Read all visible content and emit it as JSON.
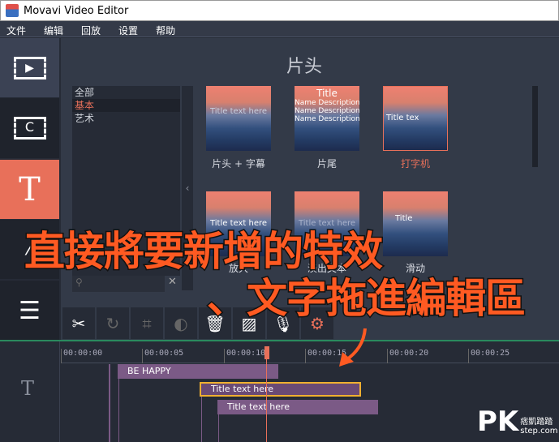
{
  "window": {
    "title": "Movavi Video Editor"
  },
  "menu": [
    "文件",
    "编辑",
    "回放",
    "设置",
    "帮助"
  ],
  "panel": {
    "title": "片头",
    "categories": [
      {
        "label": "全部",
        "selected": false
      },
      {
        "label": "基本",
        "selected": true
      },
      {
        "label": "艺术",
        "selected": false
      }
    ],
    "thumbs": [
      {
        "label": "片头 + 字幕",
        "text": "Title text here"
      },
      {
        "label": "片尾",
        "text": "Title",
        "sub": "Name Description\nName Description\nName Description"
      },
      {
        "label": "打字机",
        "text": "Title tex",
        "selected": true
      },
      {
        "label": "放大",
        "text": "Title text here"
      },
      {
        "label": "淡出文本",
        "text": "Title text here"
      },
      {
        "label": "滑动",
        "text": "Title"
      }
    ]
  },
  "timeline": {
    "ticks": [
      "00:00:00",
      "00:00:05",
      "00:00:10",
      "00:00:15",
      "00:00:20",
      "00:00:25"
    ],
    "clips": [
      "BE HAPPY",
      "Title text here",
      "Title text here"
    ]
  },
  "overlay": {
    "line1": "直接將要新增的特效",
    "line2": "、文字拖進編輯區"
  },
  "watermark": {
    "logo": "PK",
    "name": "痞凱踏踏",
    "site": "step.com"
  },
  "colors": {
    "accent": "#e8705a",
    "clip": "#7b5a86",
    "selected_border": "#f0b030",
    "overlay": "#ff5a22"
  }
}
